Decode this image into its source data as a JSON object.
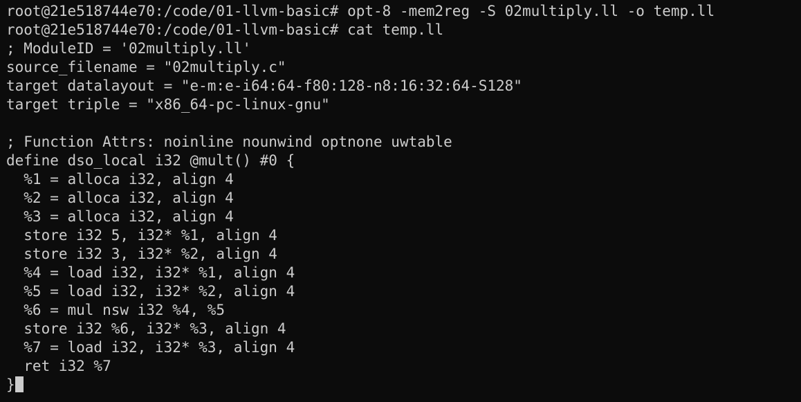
{
  "terminal": {
    "foreground": "#cccccc",
    "background": "#0c0c0c",
    "lines": [
      "root@21e518744e70:/code/01-llvm-basic# opt-8 -mem2reg -S 02multiply.ll -o temp.ll",
      "root@21e518744e70:/code/01-llvm-basic# cat temp.ll",
      "; ModuleID = '02multiply.ll'",
      "source_filename = \"02multiply.c\"",
      "target datalayout = \"e-m:e-i64:64-f80:128-n8:16:32:64-S128\"",
      "target triple = \"x86_64-pc-linux-gnu\"",
      "",
      "; Function Attrs: noinline nounwind optnone uwtable",
      "define dso_local i32 @mult() #0 {",
      "  %1 = alloca i32, align 4",
      "  %2 = alloca i32, align 4",
      "  %3 = alloca i32, align 4",
      "  store i32 5, i32* %1, align 4",
      "  store i32 3, i32* %2, align 4",
      "  %4 = load i32, i32* %1, align 4",
      "  %5 = load i32, i32* %2, align 4",
      "  %6 = mul nsw i32 %4, %5",
      "  store i32 %6, i32* %3, align 4",
      "  %7 = load i32, i32* %3, align 4",
      "  ret i32 %7",
      "}"
    ]
  }
}
